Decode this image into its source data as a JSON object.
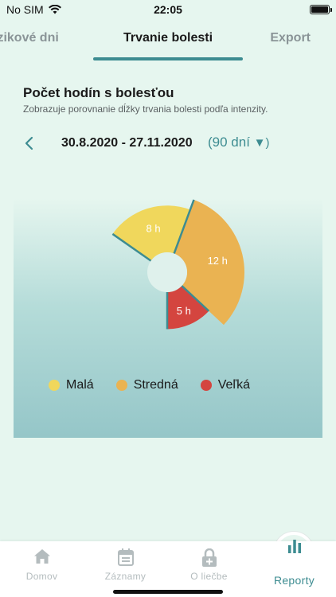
{
  "status_bar": {
    "carrier": "No SIM",
    "time": "22:05"
  },
  "tabs": {
    "left": "izikové dni",
    "center": "Trvanie bolesti",
    "right": "Export"
  },
  "section": {
    "title": "Počet hodín s bolesťou",
    "subtitle": "Zobrazuje porovnanie dĺžky trvania bolesti podľa intenzity."
  },
  "date_range": {
    "range": "30.8.2020 - 27.11.2020",
    "period": "(90 dní",
    "caret": "▼)"
  },
  "chart_data": {
    "type": "pie",
    "categories": [
      "Malá",
      "Stredná",
      "Veľká"
    ],
    "values": [
      8,
      12,
      5
    ],
    "labels": [
      "8 h",
      "12 h",
      "5 h"
    ],
    "colors": [
      "#f0d75c",
      "#eab352",
      "#d4453f"
    ],
    "title": "",
    "legend": "bottom"
  },
  "legend": {
    "items": [
      {
        "label": "Malá",
        "color": "#f0d75c"
      },
      {
        "label": "Stredná",
        "color": "#eab352"
      },
      {
        "label": "Veľká",
        "color": "#d4453f"
      }
    ]
  },
  "bottom_nav": {
    "items": [
      {
        "label": "Domov",
        "icon": "home-icon"
      },
      {
        "label": "Záznamy",
        "icon": "calendar-icon"
      },
      {
        "label": "O liečbe",
        "icon": "medical-lock-icon"
      },
      {
        "label": "Reporty",
        "icon": "bar-chart-icon"
      }
    ]
  },
  "colors": {
    "accent": "#3d8c91",
    "background": "#e6f6ef",
    "inactive": "#b4bcbe"
  }
}
